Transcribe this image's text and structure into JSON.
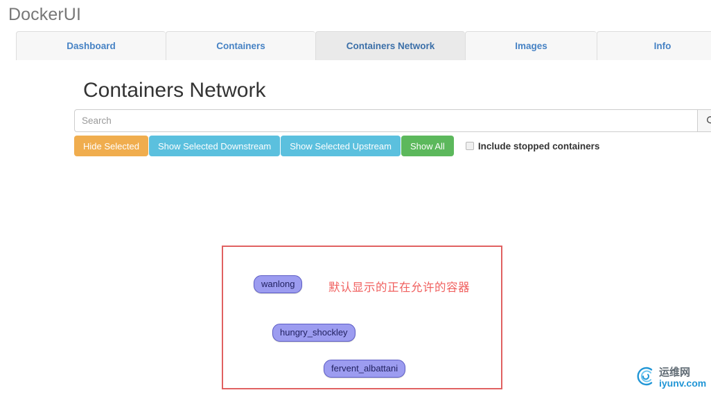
{
  "app": {
    "brand": "DockerUI"
  },
  "nav": {
    "tabs": [
      {
        "label": "Dashboard",
        "active": false
      },
      {
        "label": "Containers",
        "active": false
      },
      {
        "label": "Containers Network",
        "active": true
      },
      {
        "label": "Images",
        "active": false
      },
      {
        "label": "Info",
        "active": false
      }
    ]
  },
  "main": {
    "title": "Containers Network",
    "search": {
      "placeholder": "Search",
      "value": "",
      "button_icon": "search-icon"
    },
    "actions": [
      {
        "label": "Hide Selected",
        "color": "#f0ad4e"
      },
      {
        "label": "Show Selected Downstream",
        "color": "#5bc0de"
      },
      {
        "label": "Show Selected Upstream",
        "color": "#5bc0de"
      },
      {
        "label": "Show All",
        "color": "#5cb85c"
      }
    ],
    "include_stopped": {
      "label": "Include stopped containers",
      "checked": false
    }
  },
  "graph": {
    "annotation": "默认显示的正在允许的容器",
    "annotation_color": "#f0605f",
    "box_border_color": "#e06060",
    "node_fill": "#9c9cf0",
    "node_border": "#5b5bc4",
    "nodes": [
      {
        "label": "wanlong"
      },
      {
        "label": "hungry_shockley"
      },
      {
        "label": "fervent_albattani"
      }
    ]
  },
  "watermark": {
    "cn": "运维网",
    "en": "iyunv.com",
    "accent": "#2196d6"
  }
}
